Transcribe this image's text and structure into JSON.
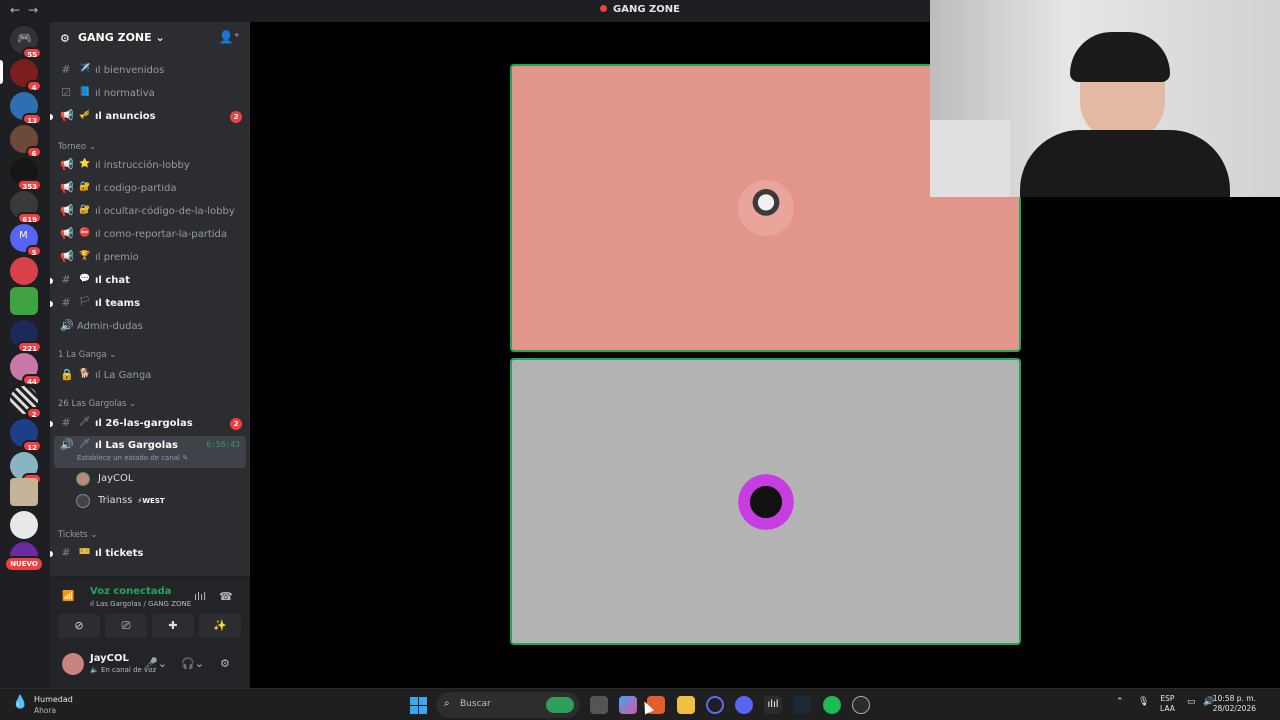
{
  "window": {
    "title": "GANG ZONE",
    "nav_back": "←",
    "nav_forward": "→"
  },
  "rail": {
    "badges": [
      "55",
      "4",
      "13",
      "6",
      "353",
      "619",
      "5",
      "",
      "",
      "221",
      "44",
      "2",
      "12",
      "21",
      "",
      "",
      ""
    ],
    "new_label": "NUEVO",
    "server_m_letter": "M"
  },
  "server": {
    "name": "GANG ZONE",
    "chevron": "⌄"
  },
  "channels": [
    {
      "id": "bienvenidos",
      "icon": "#",
      "emoji": "✈️",
      "name": "ıl bienvenidos",
      "bold": false
    },
    {
      "id": "normativa",
      "icon": "☑",
      "emoji": "📘",
      "name": "ıl normativa",
      "bold": false
    },
    {
      "id": "anuncios",
      "icon": "📢",
      "emoji": "🎺",
      "name": "ıl anuncios",
      "bold": true,
      "mentions": "2"
    }
  ],
  "categories": {
    "torneo": "Torneo",
    "la_ganga": "1 La Ganga",
    "las_gargolas": "26 Las Gargolas",
    "tickets": "Tickets"
  },
  "torneo_channels": [
    {
      "icon": "📢",
      "emoji": "⭐",
      "name": "ıl instrucción-lobby",
      "bold": false
    },
    {
      "icon": "📢",
      "emoji": "🔐",
      "name": "ıl codigo-partida",
      "bold": false
    },
    {
      "icon": "📢",
      "emoji": "🔐",
      "name": "ıl ocultar-código-de-la-lobby",
      "bold": false
    },
    {
      "icon": "📢",
      "emoji": "⛔",
      "name": "ıl como-reportar-la-partida",
      "bold": false
    },
    {
      "icon": "📢",
      "emoji": "🏆",
      "name": "ıl premio",
      "bold": false
    },
    {
      "icon": "#",
      "emoji": "💬",
      "name": "ıl chat",
      "bold": true
    },
    {
      "icon": "#",
      "emoji": "🏳",
      "name": "ıl teams",
      "bold": true
    },
    {
      "icon": "🔊",
      "emoji": "",
      "name": "Admin-dudas",
      "bold": false
    }
  ],
  "la_ganga_channel": {
    "icon": "🔒",
    "emoji": "🐕",
    "name": "ıl La Ganga"
  },
  "gargolas_text": {
    "icon": "#",
    "emoji": "🗡",
    "name": "ıl 26-las-gargolas",
    "mentions": "2"
  },
  "gargolas_voice": {
    "emoji": "🗡",
    "name": "ıl Las Gargolas",
    "timer": "6:56:43",
    "status_placeholder": "Establece un estado de canal ✎",
    "members": [
      {
        "name": "JayCOL",
        "tag": ""
      },
      {
        "name": "Trianss",
        "tag": "⚡WEST"
      }
    ]
  },
  "tickets_channel": {
    "icon": "#",
    "emoji": "🎫",
    "name": "ıl tickets"
  },
  "voice": {
    "connected_label": "Voz conectada",
    "location": "ıl Las Gargolas / GANG ZONE",
    "buttons": [
      "⊘",
      "⎚",
      "✚",
      "✨"
    ]
  },
  "user": {
    "name": "JayCOL",
    "status": "En canal de voz"
  },
  "taskbar": {
    "weather_title": "Humedad",
    "weather_sub": "Ahora",
    "search_placeholder": "Buscar",
    "lang_1": "ESP",
    "lang_2": "LAA",
    "time": "10:58 p. m.",
    "date": "28/02/2026"
  },
  "colors": {
    "accent_green": "#23a55a",
    "mention_red": "#f23f42",
    "tile1_bg": "#e2958b",
    "tile2_bg": "#b3b3b3"
  }
}
